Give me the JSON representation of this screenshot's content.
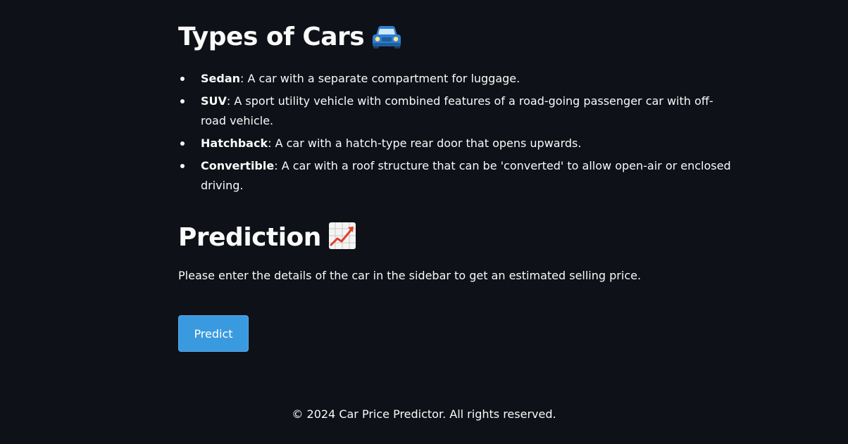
{
  "types_section": {
    "title": "Types of Cars",
    "icon": "car-icon",
    "items": [
      {
        "name": "Sedan",
        "desc": ": A car with a separate compartment for luggage."
      },
      {
        "name": "SUV",
        "desc": ": A sport utility vehicle with combined features of a road-going passenger car with off-road vehicle."
      },
      {
        "name": "Hatchback",
        "desc": ": A car with a hatch-type rear door that opens upwards."
      },
      {
        "name": "Convertible",
        "desc": ": A car with a roof structure that can be 'converted' to allow open-air or enclosed driving."
      }
    ]
  },
  "prediction_section": {
    "title": "Prediction",
    "icon": "chart-increasing-icon",
    "intro": "Please enter the details of the car in the sidebar to get an estimated selling price.",
    "button_label": "Predict"
  },
  "footer": {
    "text": "© 2024 Car Price Predictor. All rights reserved."
  },
  "colors": {
    "background": "#0e1117",
    "text": "#fafafa",
    "button": "#3a9ae0"
  }
}
